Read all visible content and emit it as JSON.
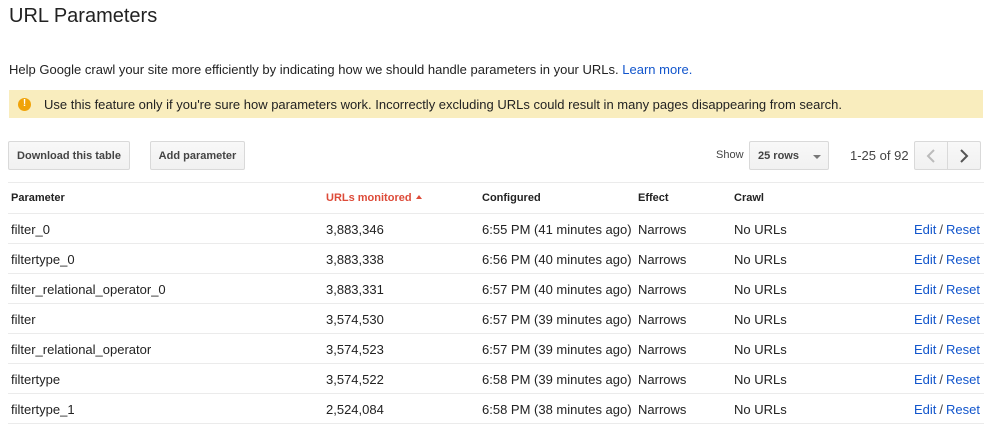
{
  "title": "URL Parameters",
  "intro": {
    "text": "Help Google crawl your site more efficiently by indicating how we should handle parameters in your URLs.",
    "link": "Learn more."
  },
  "warning": {
    "icon": "warning-icon",
    "text": "Use this feature only if you're sure how parameters work. Incorrectly excluding URLs could result in many pages disappearing from search."
  },
  "toolbar": {
    "download_label": "Download this table",
    "add_label": "Add parameter",
    "show_label": "Show",
    "rows_value": "25 rows",
    "range_text": "1-25 of 92"
  },
  "columns": {
    "parameter": "Parameter",
    "urls": "URLs monitored",
    "configured": "Configured",
    "effect": "Effect",
    "crawl": "Crawl"
  },
  "actions": {
    "edit": "Edit",
    "sep": "/",
    "reset": "Reset"
  },
  "rows": [
    {
      "parameter": "filter_0",
      "urls": "3,883,346",
      "configured": "6:55 PM (41 minutes ago)",
      "effect": "Narrows",
      "crawl": "No URLs"
    },
    {
      "parameter": "filtertype_0",
      "urls": "3,883,338",
      "configured": "6:56 PM (40 minutes ago)",
      "effect": "Narrows",
      "crawl": "No URLs"
    },
    {
      "parameter": "filter_relational_operator_0",
      "urls": "3,883,331",
      "configured": "6:57 PM (40 minutes ago)",
      "effect": "Narrows",
      "crawl": "No URLs"
    },
    {
      "parameter": "filter",
      "urls": "3,574,530",
      "configured": "6:57 PM (39 minutes ago)",
      "effect": "Narrows",
      "crawl": "No URLs"
    },
    {
      "parameter": "filter_relational_operator",
      "urls": "3,574,523",
      "configured": "6:57 PM (39 minutes ago)",
      "effect": "Narrows",
      "crawl": "No URLs"
    },
    {
      "parameter": "filtertype",
      "urls": "3,574,522",
      "configured": "6:58 PM (39 minutes ago)",
      "effect": "Narrows",
      "crawl": "No URLs"
    },
    {
      "parameter": "filtertype_1",
      "urls": "2,524,084",
      "configured": "6:58 PM (38 minutes ago)",
      "effect": "Narrows",
      "crawl": "No URLs"
    }
  ],
  "colors": {
    "link": "#1155cc",
    "sorted_header": "#dd4b39",
    "warning_bg": "#f9edbe",
    "warning_icon": "#f0a30a"
  }
}
